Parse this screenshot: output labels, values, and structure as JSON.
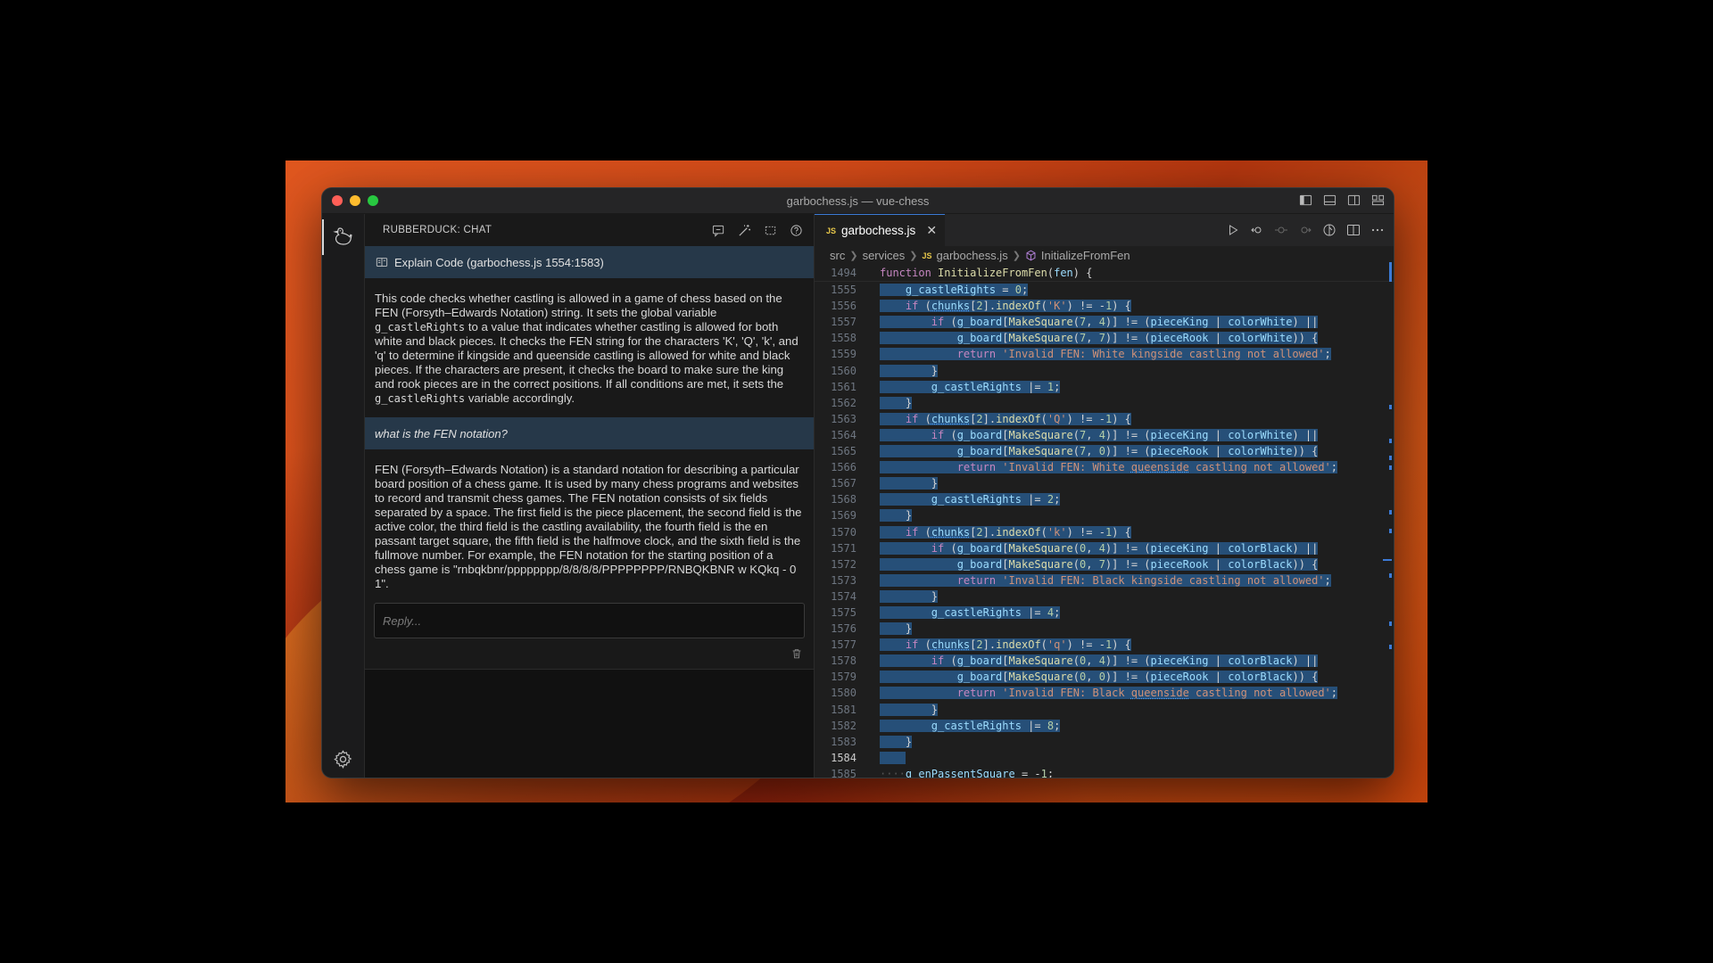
{
  "window": {
    "title": "garbochess.js — vue-chess"
  },
  "chat": {
    "header_title": "RUBBERDUCK: CHAT",
    "explain_label": "Explain Code (garbochess.js 1554:1583)",
    "answer1": [
      {
        "t": "This code checks whether castling is allowed in a game of chess based on the FEN (Forsyth–Edwards Notation) string. It sets the global variable "
      },
      {
        "c": "g_castleRights"
      },
      {
        "t": " to a value that indicates whether castling is allowed for both white and black pieces. It checks the FEN string for the characters 'K', 'Q', 'k', and 'q' to determine if kingside and queenside castling is allowed for white and black pieces. If the characters are present, it checks the board to make sure the king and rook pieces are in the correct positions. If all conditions are met, it sets the "
      },
      {
        "c": "g_castleRights"
      },
      {
        "t": " variable accordingly."
      }
    ],
    "question": "what is the FEN notation?",
    "answer2": "FEN (Forsyth–Edwards Notation) is a standard notation for describing a particular board position of a chess game. It is used by many chess programs and websites to record and transmit chess games. The FEN notation consists of six fields separated by a space. The first field is the piece placement, the second field is the active color, the third field is the castling availability, the fourth field is the en passant target square, the fifth field is the halfmove clock, and the sixth field is the fullmove number. For example, the FEN notation for the starting position of a chess game is \"rnbqkbnr/pppppppp/8/8/8/8/PPPPPPPP/RNBQKBNR w KQkq - 0 1\".",
    "reply_placeholder": "Reply..."
  },
  "editor": {
    "tab_label": "garbochess.js",
    "tab_icon": "JS",
    "breadcrumbs": [
      "src",
      "services",
      "garbochess.js",
      "InitializeFromFen"
    ],
    "sticky": {
      "ln": "1494",
      "code": [
        [
          "kw",
          "function "
        ],
        [
          "fn",
          "InitializeFromFen"
        ],
        [
          "plain",
          "("
        ],
        [
          "var",
          "fen"
        ],
        [
          "plain",
          ") {"
        ]
      ]
    },
    "current_line": "1584",
    "lines": [
      {
        "ln": "1555",
        "sel": true,
        "code": [
          [
            "plain",
            "    "
          ],
          [
            "var",
            "g_castleRights"
          ],
          [
            "plain",
            " = "
          ],
          [
            "num",
            "0"
          ],
          [
            "plain",
            ";"
          ]
        ]
      },
      {
        "ln": "1556",
        "sel": true,
        "code": [
          [
            "plain",
            "    "
          ],
          [
            "kw",
            "if"
          ],
          [
            "plain",
            " ("
          ],
          [
            "var",
            "chunks"
          ],
          [
            "plain",
            "["
          ],
          [
            "num",
            "2"
          ],
          [
            "plain",
            "]."
          ],
          [
            "fn",
            "indexOf"
          ],
          [
            "plain",
            "("
          ],
          [
            "str",
            "'K'"
          ],
          [
            "plain",
            ") != -"
          ],
          [
            "num",
            "1"
          ],
          [
            "plain",
            ") {"
          ]
        ]
      },
      {
        "ln": "1557",
        "sel": true,
        "code": [
          [
            "plain",
            "        "
          ],
          [
            "kw",
            "if"
          ],
          [
            "plain",
            " ("
          ],
          [
            "var",
            "g_board"
          ],
          [
            "plain",
            "["
          ],
          [
            "fn",
            "MakeSquare"
          ],
          [
            "plain",
            "("
          ],
          [
            "num",
            "7"
          ],
          [
            "plain",
            ", "
          ],
          [
            "num",
            "4"
          ],
          [
            "plain",
            ")] != ("
          ],
          [
            "var",
            "pieceKing"
          ],
          [
            "plain",
            " | "
          ],
          [
            "var",
            "colorWhite"
          ],
          [
            "plain",
            ") ||"
          ]
        ]
      },
      {
        "ln": "1558",
        "sel": true,
        "code": [
          [
            "plain",
            "            "
          ],
          [
            "var",
            "g_board"
          ],
          [
            "plain",
            "["
          ],
          [
            "fn",
            "MakeSquare"
          ],
          [
            "plain",
            "("
          ],
          [
            "num",
            "7"
          ],
          [
            "plain",
            ", "
          ],
          [
            "num",
            "7"
          ],
          [
            "plain",
            ")] != ("
          ],
          [
            "var",
            "pieceRook"
          ],
          [
            "plain",
            " | "
          ],
          [
            "var",
            "colorWhite"
          ],
          [
            "plain",
            ")) {"
          ]
        ]
      },
      {
        "ln": "1559",
        "sel": true,
        "code": [
          [
            "plain",
            "            "
          ],
          [
            "kw",
            "return"
          ],
          [
            "plain",
            " "
          ],
          [
            "str",
            "'Invalid FEN: White kingside castling not allowed'"
          ],
          [
            "plain",
            ";"
          ]
        ]
      },
      {
        "ln": "1560",
        "sel": true,
        "code": [
          [
            "plain",
            "        }"
          ]
        ]
      },
      {
        "ln": "1561",
        "sel": true,
        "code": [
          [
            "plain",
            "        "
          ],
          [
            "var",
            "g_castleRights"
          ],
          [
            "plain",
            " |= "
          ],
          [
            "num",
            "1"
          ],
          [
            "plain",
            ";"
          ]
        ]
      },
      {
        "ln": "1562",
        "sel": true,
        "code": [
          [
            "plain",
            "    }"
          ]
        ]
      },
      {
        "ln": "1563",
        "sel": true,
        "code": [
          [
            "plain",
            "    "
          ],
          [
            "kw",
            "if"
          ],
          [
            "plain",
            " ("
          ],
          [
            "var",
            "chunks"
          ],
          [
            "plain",
            "["
          ],
          [
            "num",
            "2"
          ],
          [
            "plain",
            "]."
          ],
          [
            "fn",
            "indexOf"
          ],
          [
            "plain",
            "("
          ],
          [
            "str",
            "'Q'"
          ],
          [
            "plain",
            ") != -"
          ],
          [
            "num",
            "1"
          ],
          [
            "plain",
            ") {"
          ]
        ]
      },
      {
        "ln": "1564",
        "sel": true,
        "code": [
          [
            "plain",
            "        "
          ],
          [
            "kw",
            "if"
          ],
          [
            "plain",
            " ("
          ],
          [
            "var",
            "g_board"
          ],
          [
            "plain",
            "["
          ],
          [
            "fn",
            "MakeSquare"
          ],
          [
            "plain",
            "("
          ],
          [
            "num",
            "7"
          ],
          [
            "plain",
            ", "
          ],
          [
            "num",
            "4"
          ],
          [
            "plain",
            ")] != ("
          ],
          [
            "var",
            "pieceKing"
          ],
          [
            "plain",
            " | "
          ],
          [
            "var",
            "colorWhite"
          ],
          [
            "plain",
            ") ||"
          ]
        ]
      },
      {
        "ln": "1565",
        "sel": true,
        "code": [
          [
            "plain",
            "            "
          ],
          [
            "var",
            "g_board"
          ],
          [
            "plain",
            "["
          ],
          [
            "fn",
            "MakeSquare"
          ],
          [
            "plain",
            "("
          ],
          [
            "num",
            "7"
          ],
          [
            "plain",
            ", "
          ],
          [
            "num",
            "0"
          ],
          [
            "plain",
            ")] != ("
          ],
          [
            "var",
            "pieceRook"
          ],
          [
            "plain",
            " | "
          ],
          [
            "var",
            "colorWhite"
          ],
          [
            "plain",
            ")) {"
          ]
        ]
      },
      {
        "ln": "1566",
        "sel": true,
        "code": [
          [
            "plain",
            "            "
          ],
          [
            "kw",
            "return"
          ],
          [
            "plain",
            " "
          ],
          [
            "str",
            "'Invalid FEN: White queenside castling not allowed'"
          ],
          [
            "plain",
            ";"
          ]
        ]
      },
      {
        "ln": "1567",
        "sel": true,
        "code": [
          [
            "plain",
            "        }"
          ]
        ]
      },
      {
        "ln": "1568",
        "sel": true,
        "code": [
          [
            "plain",
            "        "
          ],
          [
            "var",
            "g_castleRights"
          ],
          [
            "plain",
            " |= "
          ],
          [
            "num",
            "2"
          ],
          [
            "plain",
            ";"
          ]
        ]
      },
      {
        "ln": "1569",
        "sel": true,
        "code": [
          [
            "plain",
            "    }"
          ]
        ]
      },
      {
        "ln": "1570",
        "sel": true,
        "code": [
          [
            "plain",
            "    "
          ],
          [
            "kw",
            "if"
          ],
          [
            "plain",
            " ("
          ],
          [
            "var",
            "chunks"
          ],
          [
            "plain",
            "["
          ],
          [
            "num",
            "2"
          ],
          [
            "plain",
            "]."
          ],
          [
            "fn",
            "indexOf"
          ],
          [
            "plain",
            "("
          ],
          [
            "str",
            "'k'"
          ],
          [
            "plain",
            ") != -"
          ],
          [
            "num",
            "1"
          ],
          [
            "plain",
            ") {"
          ]
        ]
      },
      {
        "ln": "1571",
        "sel": true,
        "code": [
          [
            "plain",
            "        "
          ],
          [
            "kw",
            "if"
          ],
          [
            "plain",
            " ("
          ],
          [
            "var",
            "g_board"
          ],
          [
            "plain",
            "["
          ],
          [
            "fn",
            "MakeSquare"
          ],
          [
            "plain",
            "("
          ],
          [
            "num",
            "0"
          ],
          [
            "plain",
            ", "
          ],
          [
            "num",
            "4"
          ],
          [
            "plain",
            ")] != ("
          ],
          [
            "var",
            "pieceKing"
          ],
          [
            "plain",
            " | "
          ],
          [
            "var",
            "colorBlack"
          ],
          [
            "plain",
            ") ||"
          ]
        ]
      },
      {
        "ln": "1572",
        "sel": true,
        "code": [
          [
            "plain",
            "            "
          ],
          [
            "var",
            "g_board"
          ],
          [
            "plain",
            "["
          ],
          [
            "fn",
            "MakeSquare"
          ],
          [
            "plain",
            "("
          ],
          [
            "num",
            "0"
          ],
          [
            "plain",
            ", "
          ],
          [
            "num",
            "7"
          ],
          [
            "plain",
            ")] != ("
          ],
          [
            "var",
            "pieceRook"
          ],
          [
            "plain",
            " | "
          ],
          [
            "var",
            "colorBlack"
          ],
          [
            "plain",
            ")) {"
          ]
        ]
      },
      {
        "ln": "1573",
        "sel": true,
        "code": [
          [
            "plain",
            "            "
          ],
          [
            "kw",
            "return"
          ],
          [
            "plain",
            " "
          ],
          [
            "str",
            "'Invalid FEN: Black kingside castling not allowed'"
          ],
          [
            "plain",
            ";"
          ]
        ]
      },
      {
        "ln": "1574",
        "sel": true,
        "code": [
          [
            "plain",
            "        }"
          ]
        ]
      },
      {
        "ln": "1575",
        "sel": true,
        "code": [
          [
            "plain",
            "        "
          ],
          [
            "var",
            "g_castleRights"
          ],
          [
            "plain",
            " |= "
          ],
          [
            "num",
            "4"
          ],
          [
            "plain",
            ";"
          ]
        ]
      },
      {
        "ln": "1576",
        "sel": true,
        "code": [
          [
            "plain",
            "    }"
          ]
        ]
      },
      {
        "ln": "1577",
        "sel": true,
        "code": [
          [
            "plain",
            "    "
          ],
          [
            "kw",
            "if"
          ],
          [
            "plain",
            " ("
          ],
          [
            "var",
            "chunks"
          ],
          [
            "plain",
            "["
          ],
          [
            "num",
            "2"
          ],
          [
            "plain",
            "]."
          ],
          [
            "fn",
            "indexOf"
          ],
          [
            "plain",
            "("
          ],
          [
            "str",
            "'q'"
          ],
          [
            "plain",
            ") != -"
          ],
          [
            "num",
            "1"
          ],
          [
            "plain",
            ") {"
          ]
        ]
      },
      {
        "ln": "1578",
        "sel": true,
        "code": [
          [
            "plain",
            "        "
          ],
          [
            "kw",
            "if"
          ],
          [
            "plain",
            " ("
          ],
          [
            "var",
            "g_board"
          ],
          [
            "plain",
            "["
          ],
          [
            "fn",
            "MakeSquare"
          ],
          [
            "plain",
            "("
          ],
          [
            "num",
            "0"
          ],
          [
            "plain",
            ", "
          ],
          [
            "num",
            "4"
          ],
          [
            "plain",
            ")] != ("
          ],
          [
            "var",
            "pieceKing"
          ],
          [
            "plain",
            " | "
          ],
          [
            "var",
            "colorBlack"
          ],
          [
            "plain",
            ") ||"
          ]
        ]
      },
      {
        "ln": "1579",
        "sel": true,
        "code": [
          [
            "plain",
            "            "
          ],
          [
            "var",
            "g_board"
          ],
          [
            "plain",
            "["
          ],
          [
            "fn",
            "MakeSquare"
          ],
          [
            "plain",
            "("
          ],
          [
            "num",
            "0"
          ],
          [
            "plain",
            ", "
          ],
          [
            "num",
            "0"
          ],
          [
            "plain",
            ")] != ("
          ],
          [
            "var",
            "pieceRook"
          ],
          [
            "plain",
            " | "
          ],
          [
            "var",
            "colorBlack"
          ],
          [
            "plain",
            ")) {"
          ]
        ]
      },
      {
        "ln": "1580",
        "sel": true,
        "code": [
          [
            "plain",
            "            "
          ],
          [
            "kw",
            "return"
          ],
          [
            "plain",
            " "
          ],
          [
            "str",
            "'Invalid FEN: Black queenside castling not allowed'"
          ],
          [
            "plain",
            ";"
          ]
        ]
      },
      {
        "ln": "1581",
        "sel": true,
        "code": [
          [
            "plain",
            "        }"
          ]
        ]
      },
      {
        "ln": "1582",
        "sel": true,
        "code": [
          [
            "plain",
            "        "
          ],
          [
            "var",
            "g_castleRights"
          ],
          [
            "plain",
            " |= "
          ],
          [
            "num",
            "8"
          ],
          [
            "plain",
            ";"
          ]
        ]
      },
      {
        "ln": "1583",
        "sel": true,
        "code": [
          [
            "plain",
            "    }"
          ]
        ]
      },
      {
        "ln": "1584",
        "sel": false,
        "code": [
          [
            "plain",
            ""
          ]
        ]
      },
      {
        "ln": "1585",
        "sel": false,
        "code": [
          [
            "dot",
            "····"
          ],
          [
            "var",
            "g_enPassentSquare"
          ],
          [
            "plain",
            " = -"
          ],
          [
            "num",
            "1"
          ],
          [
            "plain",
            ";"
          ]
        ]
      }
    ]
  },
  "colors": {
    "accent": "#3c7ad6",
    "selection": "#264f78",
    "chat_highlight": "#263849"
  }
}
